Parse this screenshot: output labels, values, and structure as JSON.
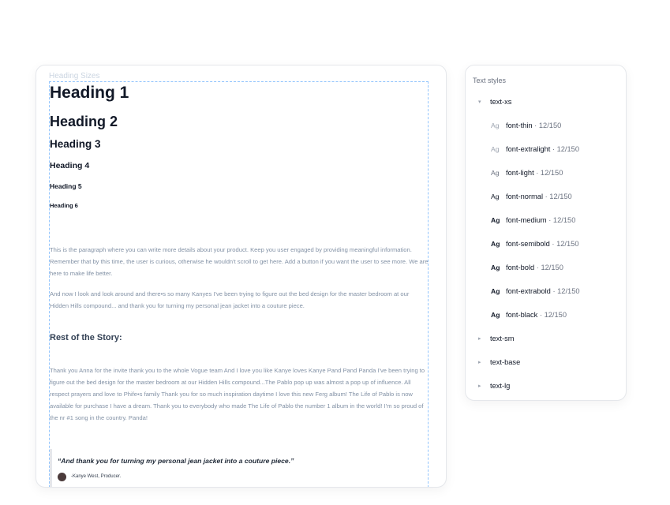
{
  "canvas": {
    "frame_label": "Heading Sizes",
    "headings": [
      "Heading 1",
      "Heading 2",
      "Heading 3",
      "Heading 4",
      "Heading 5",
      "Heading 6"
    ],
    "paragraph_1": "This is the paragraph where you can write more details about your product. Keep you user engaged by providing meaningful information. Remember that by this time, the user is curious, otherwise he wouldn't scroll to get here. Add a button if you want the user to see more. We are here to make life better.",
    "paragraph_2": "And now I look and look around and there•s so many Kanyes I've been trying to figure out the bed design for the master bedroom at our Hidden Hills compound... and thank you for turning my personal jean jacket into a couture piece.",
    "story_heading": "Rest of the Story:",
    "paragraph_3": "Thank you Anna for the invite thank you to the whole Vogue team And I love you like Kanye loves Kanye Pand Pand Panda I've been trying to figure out the bed design for the master bedroom at our Hidden Hills compound...The Pablo pop up was almost a pop up of influence. All respect prayers and love to Phife•s family Thank you for so much inspiration daytime I love this new Ferg album! The Life of Pablo is now available for purchase I have a dream. Thank you to everybody who made The Life of Pablo the number 1 album in the world! I'm so proud of the nr #1 song in the country. Panda!",
    "quote": {
      "text": "“And thank you for turning my personal jean jacket into a couture piece.”",
      "author": "-Kanye West, Producer."
    }
  },
  "text_styles": {
    "title": "Text styles",
    "expanded_group": {
      "label": "text-xs",
      "caret": "▾"
    },
    "ag_label": "Ag",
    "styles": [
      {
        "name": "font-thin",
        "meta": " · 12/150",
        "ag_color": "#9ca3af"
      },
      {
        "name": "font-extralight",
        "meta": " · 12/150",
        "ag_color": "#9ca3af"
      },
      {
        "name": "font-light",
        "meta": " · 12/150",
        "ag_color": "#6b7280"
      },
      {
        "name": "font-normal",
        "meta": " · 12/150",
        "ag_color": "#111827"
      },
      {
        "name": "font-medium",
        "meta": " · 12/150",
        "ag_color": "#111827"
      },
      {
        "name": "font-semibold",
        "meta": " · 12/150",
        "ag_color": "#111827"
      },
      {
        "name": "font-bold",
        "meta": " · 12/150",
        "ag_color": "#111827"
      },
      {
        "name": "font-extrabold",
        "meta": " · 12/150",
        "ag_color": "#111827"
      },
      {
        "name": "font-black",
        "meta": " · 12/150",
        "ag_color": "#111827"
      }
    ],
    "collapsed_groups": [
      {
        "label": "text-sm",
        "caret": "▸"
      },
      {
        "label": "text-base",
        "caret": "▸"
      },
      {
        "label": "text-lg",
        "caret": "▸"
      }
    ]
  }
}
